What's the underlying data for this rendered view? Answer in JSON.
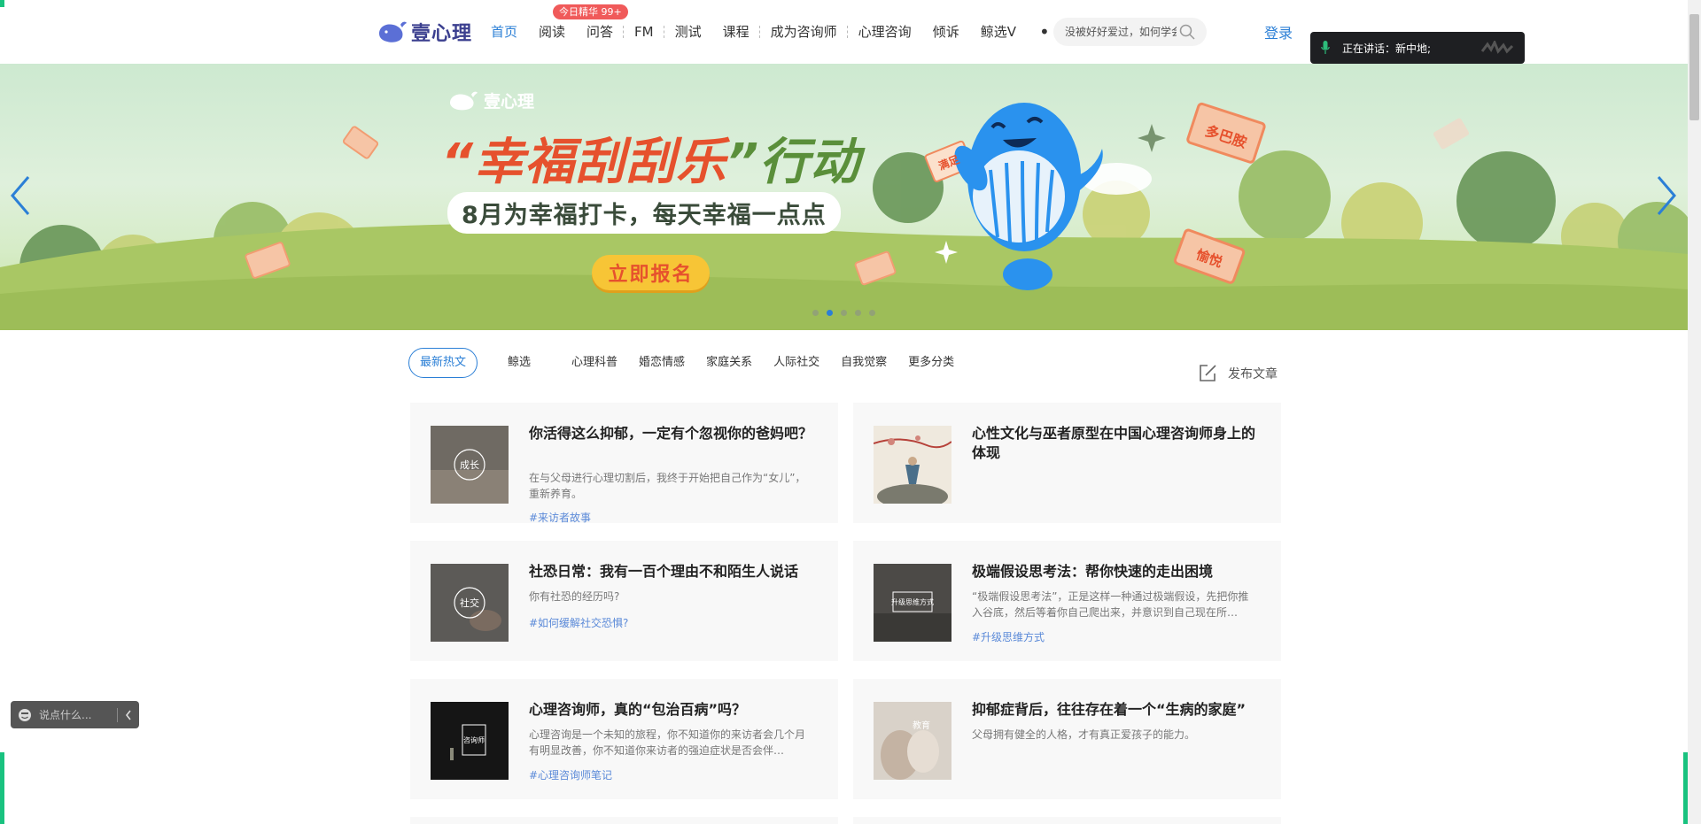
{
  "header": {
    "logo_text": "壹心理",
    "nav": [
      {
        "label": "首页",
        "active": true
      },
      {
        "label": "阅读"
      },
      {
        "label": "问答"
      },
      {
        "label": "FM"
      },
      {
        "label": "测试"
      },
      {
        "label": "课程"
      },
      {
        "label": "成为咨询师"
      },
      {
        "label": "心理咨询"
      },
      {
        "label": "倾诉"
      },
      {
        "label": "鲸选V"
      }
    ],
    "badge": "今日精华 99+",
    "more": "• • •",
    "search_placeholder": "没被好好爱过，如何学会",
    "login": "登录"
  },
  "voice_panel": {
    "text": "正在讲话：新中地;"
  },
  "banner": {
    "logo_text": "壹心理",
    "title_quote_open": "“",
    "title_red": "幸福刮刮乐",
    "title_quote_close": "”",
    "title_green": "行动",
    "subtitle": "8月为幸福打卡，每天幸福一点点",
    "cta": "立即报名",
    "ticket_labels": [
      "多巴胺",
      "满足",
      "愉悦"
    ],
    "slide_count": 5,
    "active_slide": 2
  },
  "categories": {
    "items": [
      "最新热文",
      "鲸选",
      "心理科普",
      "婚恋情感",
      "家庭关系",
      "人际社交",
      "自我觉察",
      "更多分类"
    ],
    "publish": "发布文章"
  },
  "articles": [
    {
      "title": "你活得这么抑郁，一定有个忽视你的爸妈吧？",
      "desc": "在与父母进行心理切割后，我终于开始把自己作为“女儿”，重新养育。",
      "tag": "#来访者故事",
      "thumb_text": "成长"
    },
    {
      "title": "心性文化与巫者原型在中国心理咨询师身上的体现",
      "desc": "",
      "tag": "",
      "thumb_text": ""
    },
    {
      "title": "社恐日常：我有一百个理由不和陌生人说话",
      "desc": "你有社恐的经历吗?",
      "tag": "#如何缓解社交恐惧?",
      "thumb_text": "社交"
    },
    {
      "title": "极端假设思考法：帮你快速的走出困境",
      "desc": "“极端假设思考法”，正是这样一种通过极端假设，先把你推入谷底，然后等着你自己爬出来，并意识到自己现在所…",
      "tag": "#升级思维方式",
      "thumb_text": "升级思维方式"
    },
    {
      "title": "心理咨询师，真的“包治百病”吗？",
      "desc": "心理咨询是一个未知的旅程，你不知道你的来访者会几个月有明显改善，你不知道你来访者的强迫症状是否会伴…",
      "tag": "#心理咨询师笔记",
      "thumb_text": "咨询师"
    },
    {
      "title": "抑郁症背后，往往存在着一个“生病的家庭”",
      "desc": "父母拥有健全的人格，才有真正爱孩子的能力。",
      "tag": "",
      "thumb_text": "教育"
    }
  ],
  "chat_widget": {
    "placeholder": "说点什么..."
  }
}
